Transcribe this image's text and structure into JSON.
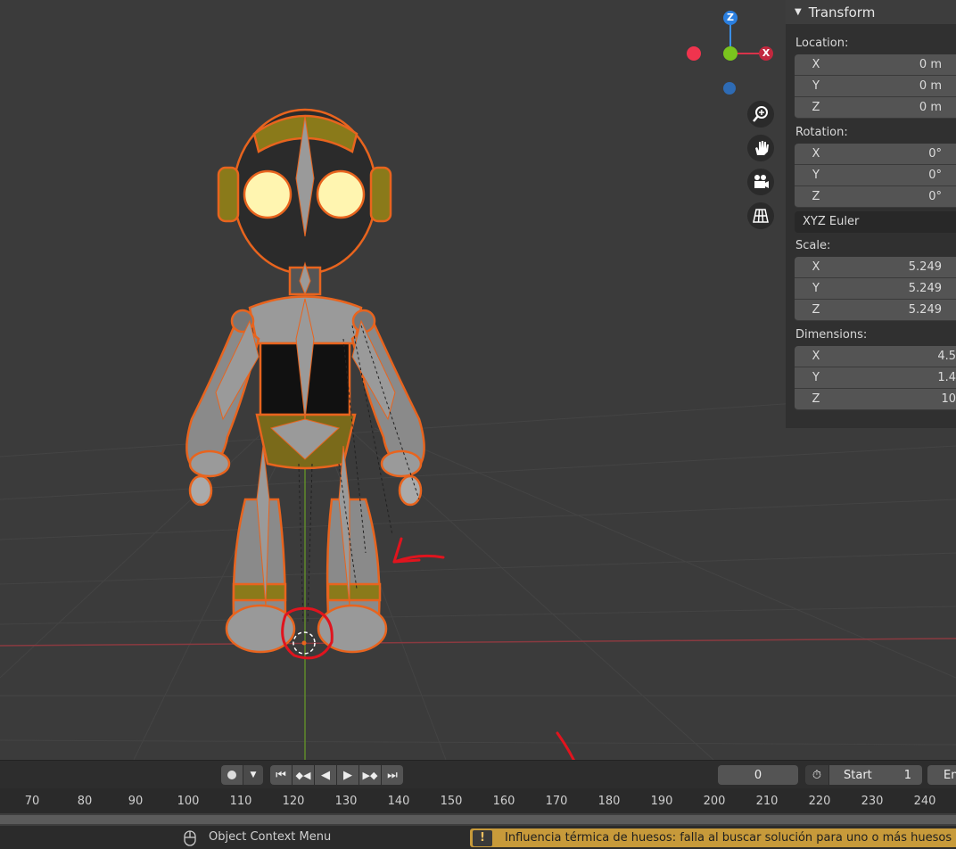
{
  "transform_panel": {
    "title": "Transform",
    "location": {
      "label": "Location:",
      "x_label": "X",
      "x": "0 m",
      "y_label": "Y",
      "y": "0 m",
      "z_label": "Z",
      "z": "0 m"
    },
    "rotation": {
      "label": "Rotation:",
      "x_label": "X",
      "x": "0°",
      "y_label": "Y",
      "y": "0°",
      "z_label": "Z",
      "z": "0°",
      "mode": "XYZ Euler"
    },
    "scale": {
      "label": "Scale:",
      "x_label": "X",
      "x": "5.249",
      "y_label": "Y",
      "y": "5.249",
      "z_label": "Z",
      "z": "5.249"
    },
    "dimensions": {
      "label": "Dimensions:",
      "x_label": "X",
      "x": "4.5",
      "y_label": "Y",
      "y": "1.4",
      "z_label": "Z",
      "z": "10"
    }
  },
  "gizmo": {
    "z": "Z",
    "x": "X"
  },
  "timeline": {
    "current_frame": "0",
    "start_label": "Start",
    "start_value": "1",
    "end_label": "En",
    "ruler": [
      "70",
      "80",
      "90",
      "100",
      "110",
      "120",
      "130",
      "140",
      "150",
      "160",
      "170",
      "180",
      "190",
      "200",
      "210",
      "220",
      "230",
      "240"
    ]
  },
  "statusbar": {
    "context_menu": "Object Context Menu",
    "warning": "Influencia térmica de huesos: falla al buscar solución para uno o más huesos"
  },
  "colors": {
    "selection_outline": "#e8641e",
    "warning_bg": "#c79a3a",
    "panel_bg": "#303030",
    "field_bg": "#545454"
  }
}
